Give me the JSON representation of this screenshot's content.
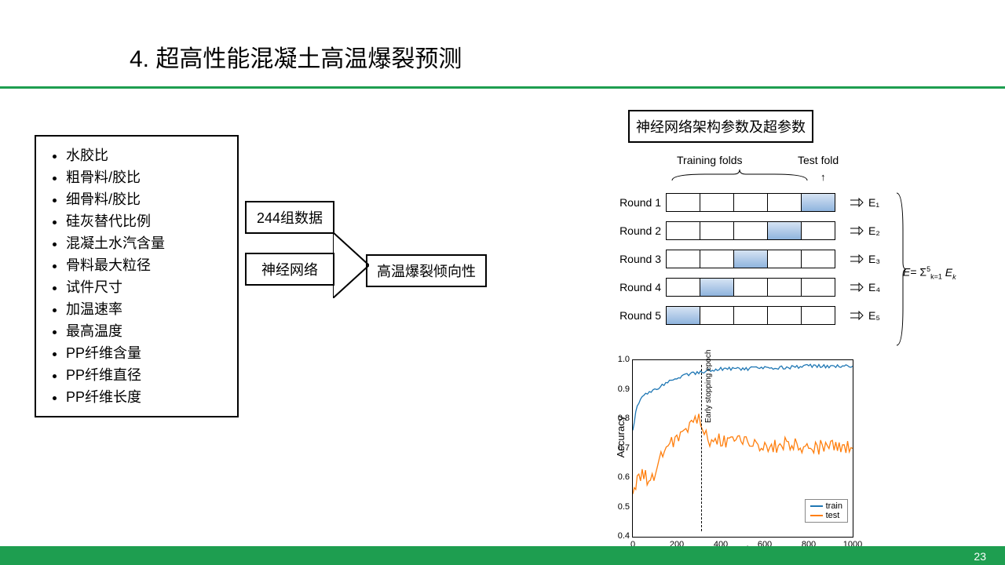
{
  "title": "4.  超高性能混凝土高温爆裂预测",
  "page_num": "23",
  "inputs": [
    "水胶比",
    "粗骨料/胶比",
    "细骨料/胶比",
    "硅灰替代比例",
    "混凝土水汽含量",
    "骨料最大粒径",
    "试件尺寸",
    "加温速率",
    "最高温度",
    "PP纤维含量",
    "PP纤维直径",
    "PP纤维长度"
  ],
  "data_label": "244组数据",
  "nn_label": "神经网络",
  "output_label": "高温爆裂倾向性",
  "arch_label": "神经网络架构参数及超参数",
  "kfold": {
    "training_label": "Training folds",
    "test_label": "Test fold",
    "rounds": [
      "Round 1",
      "Round 2",
      "Round 3",
      "Round 4",
      "Round 5"
    ],
    "test_idx": [
      4,
      3,
      2,
      1,
      0
    ],
    "errors": [
      "E₁",
      "E₂",
      "E₃",
      "E₄",
      "E₅"
    ],
    "sum": "E= ∑⁵ₖ₌₁ Eₖ"
  },
  "chart_data": {
    "type": "line",
    "title": "",
    "xlabel": "Epochs",
    "ylabel": "Accuracy",
    "xlim": [
      0,
      1000
    ],
    "ylim": [
      0.4,
      1.0
    ],
    "xticks": [
      0,
      200,
      400,
      600,
      800,
      1000
    ],
    "yticks": [
      0.4,
      0.5,
      0.6,
      0.7,
      0.8,
      0.9,
      1.0
    ],
    "early_stop_epoch": 310,
    "early_stop_label": "Early stopping epoch",
    "legend": [
      "train",
      "test"
    ],
    "series": [
      {
        "name": "train",
        "color": "#1f77b4",
        "x": [
          0,
          20,
          50,
          100,
          150,
          200,
          300,
          400,
          500,
          600,
          700,
          800,
          900,
          1000
        ],
        "y": [
          0.76,
          0.85,
          0.88,
          0.9,
          0.92,
          0.94,
          0.96,
          0.97,
          0.97,
          0.975,
          0.975,
          0.98,
          0.98,
          0.98
        ]
      },
      {
        "name": "test",
        "color": "#ff7f0e",
        "x": [
          0,
          20,
          50,
          80,
          120,
          160,
          200,
          250,
          300,
          350,
          400,
          500,
          600,
          700,
          800,
          900,
          1000
        ],
        "y": [
          0.55,
          0.6,
          0.62,
          0.58,
          0.66,
          0.7,
          0.74,
          0.78,
          0.8,
          0.72,
          0.73,
          0.72,
          0.7,
          0.72,
          0.7,
          0.71,
          0.7
        ]
      }
    ]
  }
}
